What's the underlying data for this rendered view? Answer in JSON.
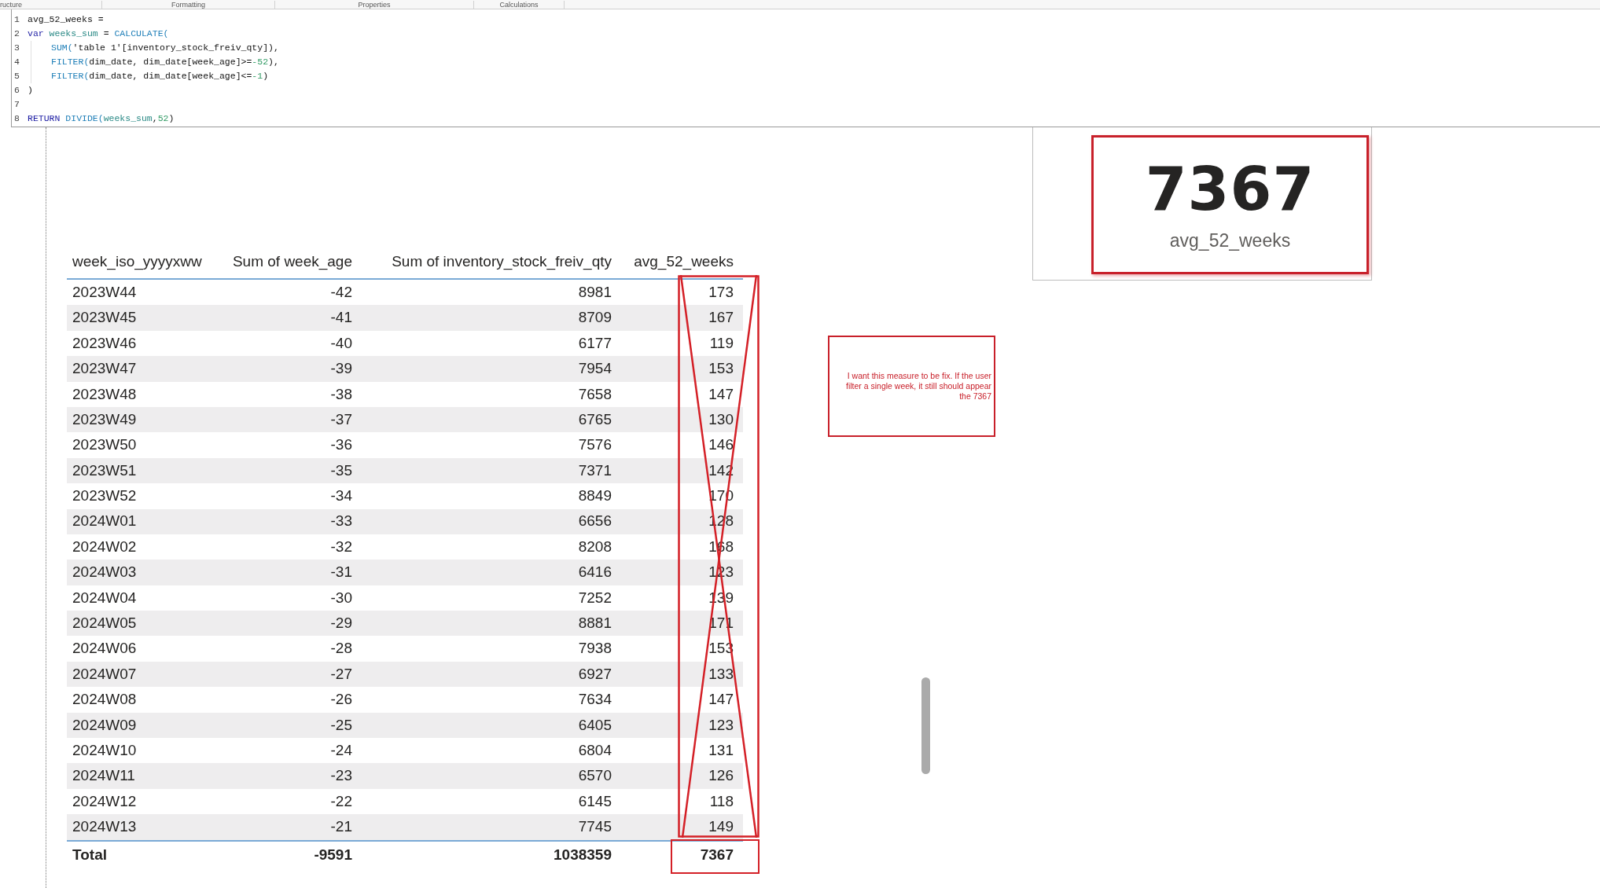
{
  "ribbon_tabs": [
    "ructure",
    "Formatting",
    "Properties",
    "Calculations"
  ],
  "formula_editor": {
    "lines": [
      {
        "number": "1",
        "indented": false,
        "tokens": [
          {
            "kind": "plain",
            "text": "avg_52_weeks ="
          }
        ]
      },
      {
        "number": "2",
        "indented": false,
        "tokens": [
          {
            "kind": "keyword",
            "text": "var"
          },
          {
            "kind": "variable",
            "text": " weeks_sum"
          },
          {
            "kind": "plain",
            "text": " = "
          },
          {
            "kind": "function",
            "text": "CALCULATE("
          }
        ]
      },
      {
        "number": "3",
        "indented": true,
        "tokens": [
          {
            "kind": "function",
            "text": "SUM("
          },
          {
            "kind": "plain",
            "text": "'table 1'[inventory_stock_freiv_qty]),"
          }
        ]
      },
      {
        "number": "4",
        "indented": true,
        "tokens": [
          {
            "kind": "function",
            "text": "FILTER("
          },
          {
            "kind": "plain",
            "text": "dim_date, dim_date[week_age]>="
          },
          {
            "kind": "number",
            "text": "-52"
          },
          {
            "kind": "plain",
            "text": "),"
          }
        ]
      },
      {
        "number": "5",
        "indented": true,
        "tokens": [
          {
            "kind": "function",
            "text": "FILTER("
          },
          {
            "kind": "plain",
            "text": "dim_date, dim_date[week_age]<="
          },
          {
            "kind": "number",
            "text": "-1"
          },
          {
            "kind": "plain",
            "text": ")"
          }
        ]
      },
      {
        "number": "6",
        "indented": false,
        "tokens": [
          {
            "kind": "plain",
            "text": ")"
          }
        ]
      },
      {
        "number": "7",
        "indented": false
      },
      {
        "number": "8",
        "indented": false,
        "tokens": [
          {
            "kind": "keyword",
            "text": "RETURN"
          },
          {
            "kind": "function",
            "text": " DIVIDE("
          },
          {
            "kind": "variable",
            "text": "weeks_sum"
          },
          {
            "kind": "plain",
            "text": ","
          },
          {
            "kind": "number",
            "text": "52"
          },
          {
            "kind": "plain",
            "text": ")"
          }
        ]
      }
    ]
  },
  "table": {
    "columns": [
      "week_iso_yyyyxww",
      "Sum of week_age",
      "Sum of inventory_stock_freiv_qty",
      "avg_52_weeks"
    ],
    "rows": [
      [
        "2023W44",
        "-42",
        "8981",
        "173"
      ],
      [
        "2023W45",
        "-41",
        "8709",
        "167"
      ],
      [
        "2023W46",
        "-40",
        "6177",
        "119"
      ],
      [
        "2023W47",
        "-39",
        "7954",
        "153"
      ],
      [
        "2023W48",
        "-38",
        "7658",
        "147"
      ],
      [
        "2023W49",
        "-37",
        "6765",
        "130"
      ],
      [
        "2023W50",
        "-36",
        "7576",
        "146"
      ],
      [
        "2023W51",
        "-35",
        "7371",
        "142"
      ],
      [
        "2023W52",
        "-34",
        "8849",
        "170"
      ],
      [
        "2024W01",
        "-33",
        "6656",
        "128"
      ],
      [
        "2024W02",
        "-32",
        "8208",
        "168"
      ],
      [
        "2024W03",
        "-31",
        "6416",
        "123"
      ],
      [
        "2024W04",
        "-30",
        "7252",
        "139"
      ],
      [
        "2024W05",
        "-29",
        "8881",
        "171"
      ],
      [
        "2024W06",
        "-28",
        "7938",
        "153"
      ],
      [
        "2024W07",
        "-27",
        "6927",
        "133"
      ],
      [
        "2024W08",
        "-26",
        "7634",
        "147"
      ],
      [
        "2024W09",
        "-25",
        "6405",
        "123"
      ],
      [
        "2024W10",
        "-24",
        "6804",
        "131"
      ],
      [
        "2024W11",
        "-23",
        "6570",
        "126"
      ],
      [
        "2024W12",
        "-22",
        "6145",
        "118"
      ],
      [
        "2024W13",
        "-21",
        "7745",
        "149"
      ]
    ],
    "total": [
      "Total",
      "-9591",
      "1038359",
      "7367"
    ]
  },
  "card": {
    "value": "7367",
    "label": "avg_52_weeks"
  },
  "note": {
    "text": "I want this measure to be fix. If the user filter a single week, it still should appear the 7367"
  }
}
